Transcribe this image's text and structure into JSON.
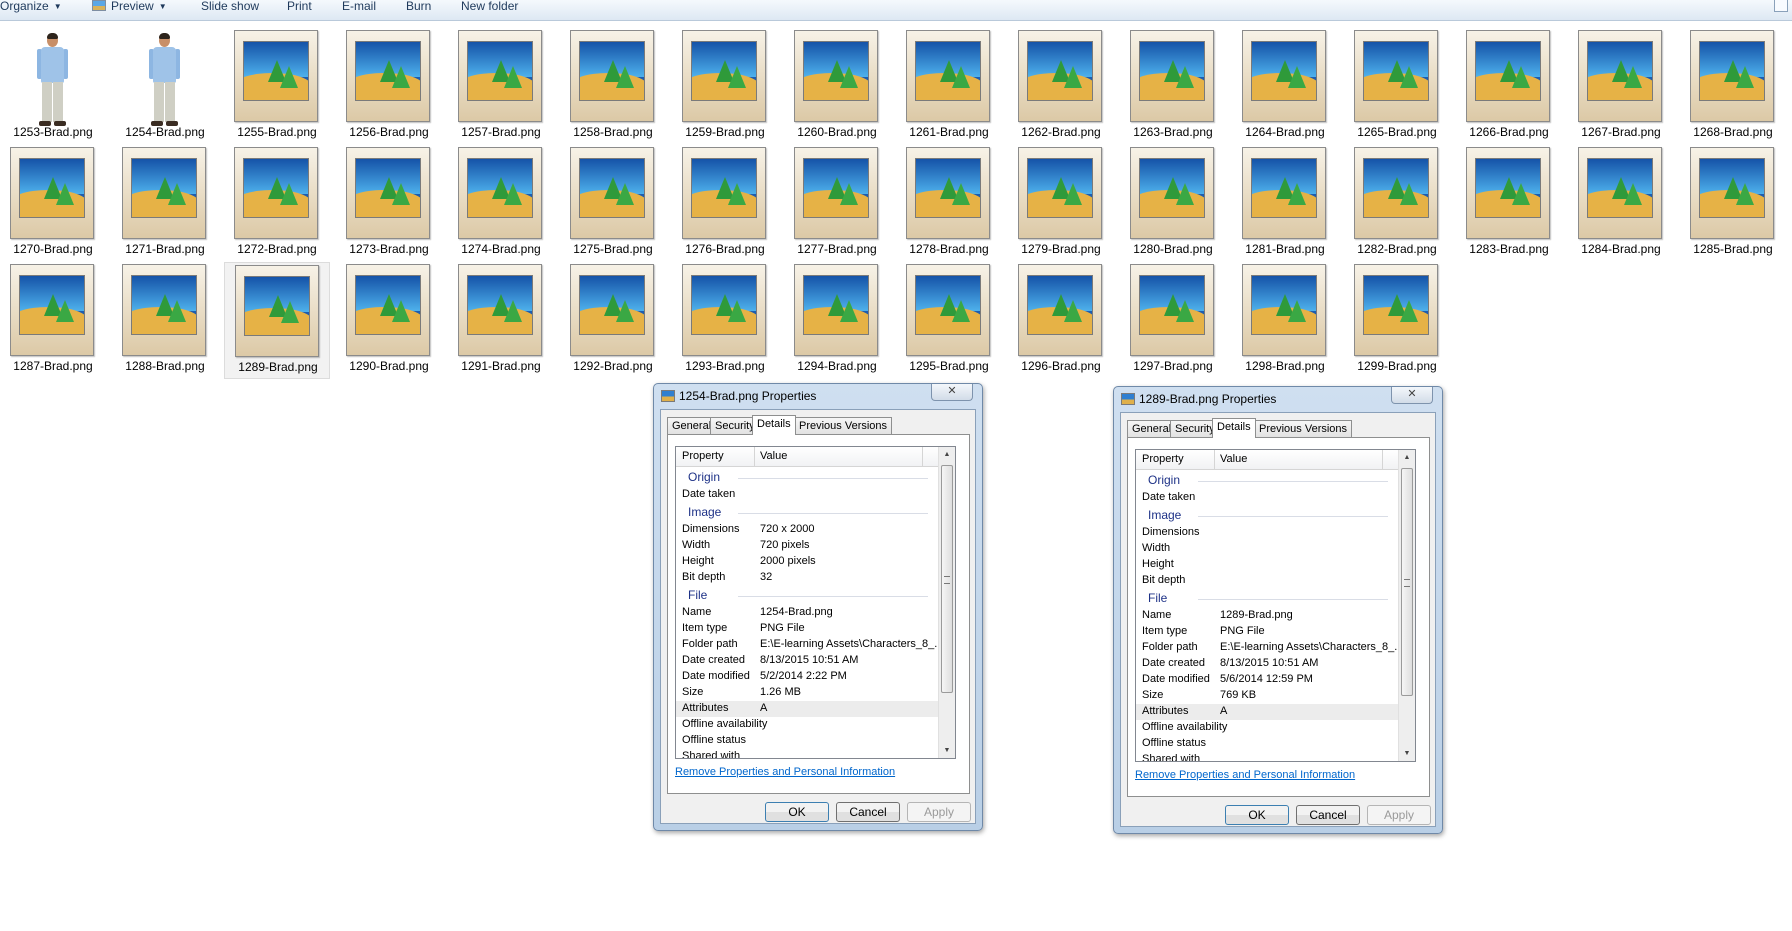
{
  "toolbar": {
    "organize": "Organize",
    "preview": "Preview",
    "slideshow": "Slide show",
    "print": "Print",
    "email": "E-mail",
    "burn": "Burn",
    "new_folder": "New folder"
  },
  "files": [
    {
      "name": "1253-Brad.png",
      "thumb": "person"
    },
    {
      "name": "1254-Brad.png",
      "thumb": "person"
    },
    {
      "name": "1255-Brad.png",
      "thumb": "generic"
    },
    {
      "name": "1256-Brad.png",
      "thumb": "generic"
    },
    {
      "name": "1257-Brad.png",
      "thumb": "generic"
    },
    {
      "name": "1258-Brad.png",
      "thumb": "generic"
    },
    {
      "name": "1259-Brad.png",
      "thumb": "generic"
    },
    {
      "name": "1260-Brad.png",
      "thumb": "generic"
    },
    {
      "name": "1261-Brad.png",
      "thumb": "generic"
    },
    {
      "name": "1262-Brad.png",
      "thumb": "generic"
    },
    {
      "name": "1263-Brad.png",
      "thumb": "generic"
    },
    {
      "name": "1264-Brad.png",
      "thumb": "generic"
    },
    {
      "name": "1265-Brad.png",
      "thumb": "generic"
    },
    {
      "name": "1266-Brad.png",
      "thumb": "generic"
    },
    {
      "name": "1267-Brad.png",
      "thumb": "generic"
    },
    {
      "name": "1268-Brad.png",
      "thumb": "generic"
    },
    {
      "name": "1270-Brad.png",
      "thumb": "generic"
    },
    {
      "name": "1271-Brad.png",
      "thumb": "generic"
    },
    {
      "name": "1272-Brad.png",
      "thumb": "generic"
    },
    {
      "name": "1273-Brad.png",
      "thumb": "generic"
    },
    {
      "name": "1274-Brad.png",
      "thumb": "generic"
    },
    {
      "name": "1275-Brad.png",
      "thumb": "generic"
    },
    {
      "name": "1276-Brad.png",
      "thumb": "generic"
    },
    {
      "name": "1277-Brad.png",
      "thumb": "generic"
    },
    {
      "name": "1278-Brad.png",
      "thumb": "generic"
    },
    {
      "name": "1279-Brad.png",
      "thumb": "generic"
    },
    {
      "name": "1280-Brad.png",
      "thumb": "generic"
    },
    {
      "name": "1281-Brad.png",
      "thumb": "generic"
    },
    {
      "name": "1282-Brad.png",
      "thumb": "generic"
    },
    {
      "name": "1283-Brad.png",
      "thumb": "generic"
    },
    {
      "name": "1284-Brad.png",
      "thumb": "generic"
    },
    {
      "name": "1285-Brad.png",
      "thumb": "generic"
    },
    {
      "name": "1287-Brad.png",
      "thumb": "generic"
    },
    {
      "name": "1288-Brad.png",
      "thumb": "generic"
    },
    {
      "name": "1289-Brad.png",
      "thumb": "generic",
      "selected": true
    },
    {
      "name": "1290-Brad.png",
      "thumb": "generic"
    },
    {
      "name": "1291-Brad.png",
      "thumb": "generic"
    },
    {
      "name": "1292-Brad.png",
      "thumb": "generic"
    },
    {
      "name": "1293-Brad.png",
      "thumb": "generic"
    },
    {
      "name": "1294-Brad.png",
      "thumb": "generic"
    },
    {
      "name": "1295-Brad.png",
      "thumb": "generic"
    },
    {
      "name": "1296-Brad.png",
      "thumb": "generic"
    },
    {
      "name": "1297-Brad.png",
      "thumb": "generic"
    },
    {
      "name": "1298-Brad.png",
      "thumb": "generic"
    },
    {
      "name": "1299-Brad.png",
      "thumb": "generic"
    }
  ],
  "dialogs": [
    {
      "title": "1254-Brad.png Properties",
      "close": "✕",
      "tabs": [
        "General",
        "Security",
        "Details",
        "Previous Versions"
      ],
      "active_tab": "Details",
      "columns": {
        "property": "Property",
        "value": "Value"
      },
      "rows": [
        {
          "type": "group",
          "label": "Origin"
        },
        {
          "type": "row",
          "key": "Date taken",
          "value": ""
        },
        {
          "type": "group",
          "label": "Image"
        },
        {
          "type": "row",
          "key": "Dimensions",
          "value": "720 x 2000"
        },
        {
          "type": "row",
          "key": "Width",
          "value": "720 pixels"
        },
        {
          "type": "row",
          "key": "Height",
          "value": "2000 pixels"
        },
        {
          "type": "row",
          "key": "Bit depth",
          "value": "32"
        },
        {
          "type": "group",
          "label": "File"
        },
        {
          "type": "row",
          "key": "Name",
          "value": "1254-Brad.png"
        },
        {
          "type": "row",
          "key": "Item type",
          "value": "PNG File"
        },
        {
          "type": "row",
          "key": "Folder path",
          "value": "E:\\E-learning Assets\\Characters_8_..."
        },
        {
          "type": "row",
          "key": "Date created",
          "value": "8/13/2015 10:51 AM"
        },
        {
          "type": "row",
          "key": "Date modified",
          "value": "5/2/2014 2:22 PM"
        },
        {
          "type": "row",
          "key": "Size",
          "value": "1.26 MB"
        },
        {
          "type": "row",
          "key": "Attributes",
          "value": "A",
          "highlight": true
        },
        {
          "type": "row",
          "key": "Offline availability",
          "value": ""
        },
        {
          "type": "row",
          "key": "Offline status",
          "value": ""
        },
        {
          "type": "row",
          "key": "Shared with",
          "value": ""
        }
      ],
      "link": "Remove Properties and Personal Information",
      "buttons": {
        "ok": "OK",
        "cancel": "Cancel",
        "apply": "Apply"
      }
    },
    {
      "title": "1289-Brad.png Properties",
      "close": "✕",
      "tabs": [
        "General",
        "Security",
        "Details",
        "Previous Versions"
      ],
      "active_tab": "Details",
      "columns": {
        "property": "Property",
        "value": "Value"
      },
      "rows": [
        {
          "type": "group",
          "label": "Origin"
        },
        {
          "type": "row",
          "key": "Date taken",
          "value": ""
        },
        {
          "type": "group",
          "label": "Image"
        },
        {
          "type": "row",
          "key": "Dimensions",
          "value": ""
        },
        {
          "type": "row",
          "key": "Width",
          "value": ""
        },
        {
          "type": "row",
          "key": "Height",
          "value": ""
        },
        {
          "type": "row",
          "key": "Bit depth",
          "value": ""
        },
        {
          "type": "group",
          "label": "File"
        },
        {
          "type": "row",
          "key": "Name",
          "value": "1289-Brad.png"
        },
        {
          "type": "row",
          "key": "Item type",
          "value": "PNG File"
        },
        {
          "type": "row",
          "key": "Folder path",
          "value": "E:\\E-learning Assets\\Characters_8_..."
        },
        {
          "type": "row",
          "key": "Date created",
          "value": "8/13/2015 10:51 AM"
        },
        {
          "type": "row",
          "key": "Date modified",
          "value": "5/6/2014 12:59 PM"
        },
        {
          "type": "row",
          "key": "Size",
          "value": "769 KB"
        },
        {
          "type": "row",
          "key": "Attributes",
          "value": "A",
          "highlight": true
        },
        {
          "type": "row",
          "key": "Offline availability",
          "value": ""
        },
        {
          "type": "row",
          "key": "Offline status",
          "value": ""
        },
        {
          "type": "row",
          "key": "Shared with",
          "value": ""
        }
      ],
      "link": "Remove Properties and Personal Information",
      "buttons": {
        "ok": "OK",
        "cancel": "Cancel",
        "apply": "Apply"
      }
    }
  ]
}
